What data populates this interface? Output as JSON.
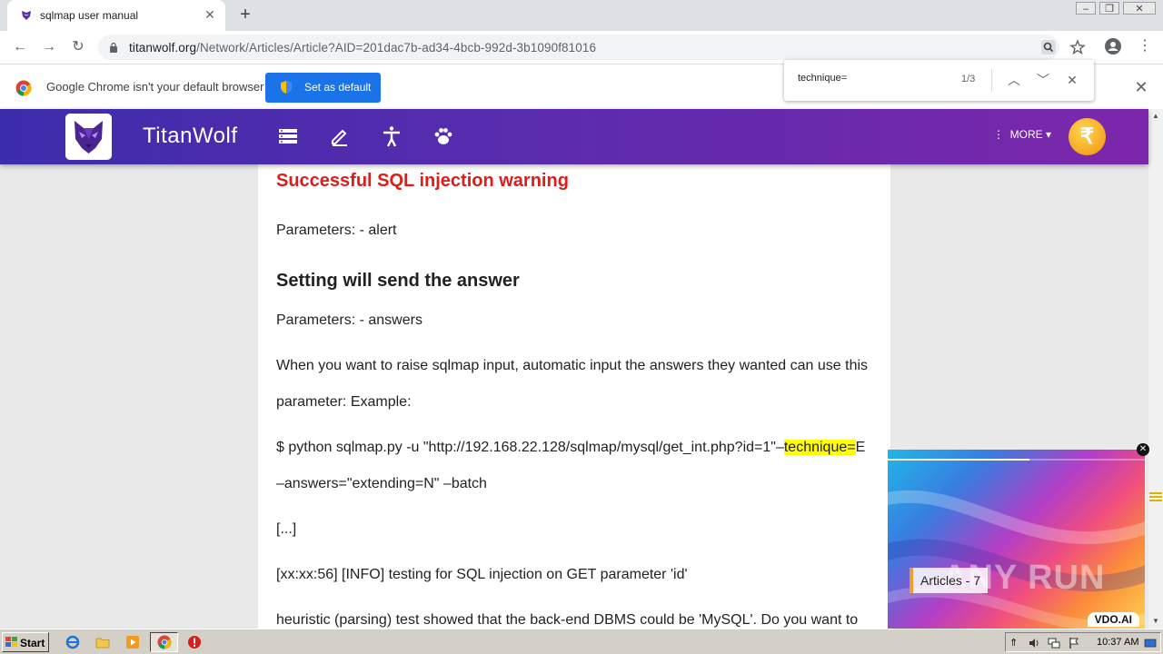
{
  "browser": {
    "tab_title": "sqlmap user manual",
    "url_host": "titanwolf.org",
    "url_path": "/Network/Articles/Article?AID=201dac7b-ad34-4bcb-992d-3b1090f81016",
    "infobar_text": "Google Chrome isn't your default browser",
    "set_default_label": "Set as default"
  },
  "find": {
    "query": "technique=",
    "count": "1/3"
  },
  "site": {
    "brand": "TitanWolf",
    "more_label": "MORE",
    "coin_symbol": "₹"
  },
  "article": {
    "warn_title": "Successful SQL injection warning",
    "p1": "Parameters: - alert",
    "sub_title": "Setting will send the answer",
    "p2": "Parameters: - answers",
    "p3_line1": "When you want to raise sqlmap input, automatic input the answers they wanted can use this",
    "p3_line2": "parameter: Example:",
    "cmd_pre": "$ python sqlmap.py -u \"http://192.168.22.128/sqlmap/mysql/get_int.php?id=1\"–",
    "cmd_hl": "technique=",
    "cmd_post": "E",
    "cmd_line2": "–answers=\"extending=N\" –batch",
    "ellipsis": "[...]",
    "log1": "[xx:xx:56] [INFO] testing for SQL injection on GET parameter 'id'",
    "log2": "heuristic (parsing) test showed that the back-end DBMS could be 'MySQL'. Do you want to"
  },
  "ad": {
    "label": "Articles - 7",
    "brand": "VDO.AI",
    "watermark": "ANY RUN",
    "progress": 0.55
  },
  "taskbar": {
    "start_label": "Start",
    "clock": "10:37 AM"
  },
  "colors": {
    "header_start": "#3c2dac",
    "header_end": "#7c27ab",
    "warn_red": "#dd1c1c",
    "highlight": "#ffff00",
    "chrome_blue": "#1a73e8"
  }
}
